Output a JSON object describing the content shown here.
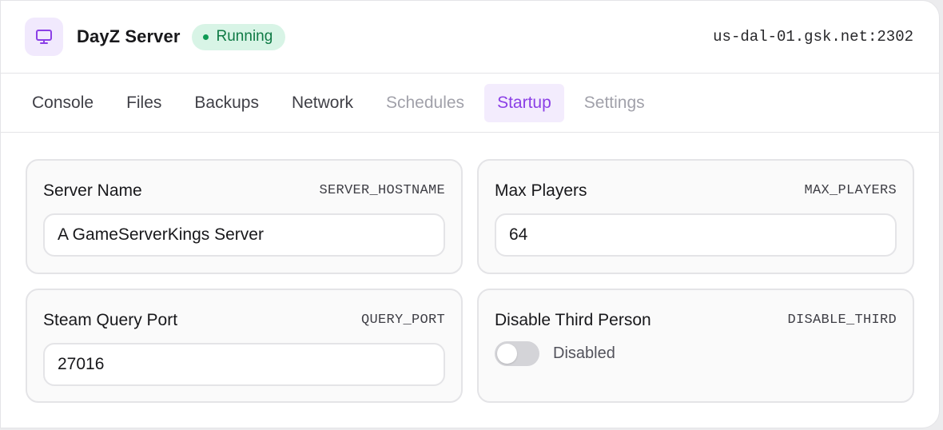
{
  "header": {
    "icon": "monitor-icon",
    "title": "DayZ Server",
    "status": "Running",
    "address": "us-dal-01.gsk.net:2302",
    "colors": {
      "accent": "#8b3fe6",
      "status_bg": "#d8f4e6",
      "status_text": "#0f7a45"
    }
  },
  "tabs": [
    {
      "label": "Console",
      "state": "normal"
    },
    {
      "label": "Files",
      "state": "normal"
    },
    {
      "label": "Backups",
      "state": "normal"
    },
    {
      "label": "Network",
      "state": "normal"
    },
    {
      "label": "Schedules",
      "state": "disabled"
    },
    {
      "label": "Startup",
      "state": "active"
    },
    {
      "label": "Settings",
      "state": "disabled"
    }
  ],
  "startup": {
    "server_name": {
      "title": "Server Name",
      "variable": "SERVER_HOSTNAME",
      "value": "A GameServerKings Server"
    },
    "max_players": {
      "title": "Max Players",
      "variable": "MAX_PLAYERS",
      "value": "64"
    },
    "query_port": {
      "title": "Steam Query Port",
      "variable": "QUERY_PORT",
      "value": "27016"
    },
    "disable_third": {
      "title": "Disable Third Person",
      "variable": "DISABLE_THIRD",
      "state": "Disabled",
      "enabled": false
    }
  }
}
